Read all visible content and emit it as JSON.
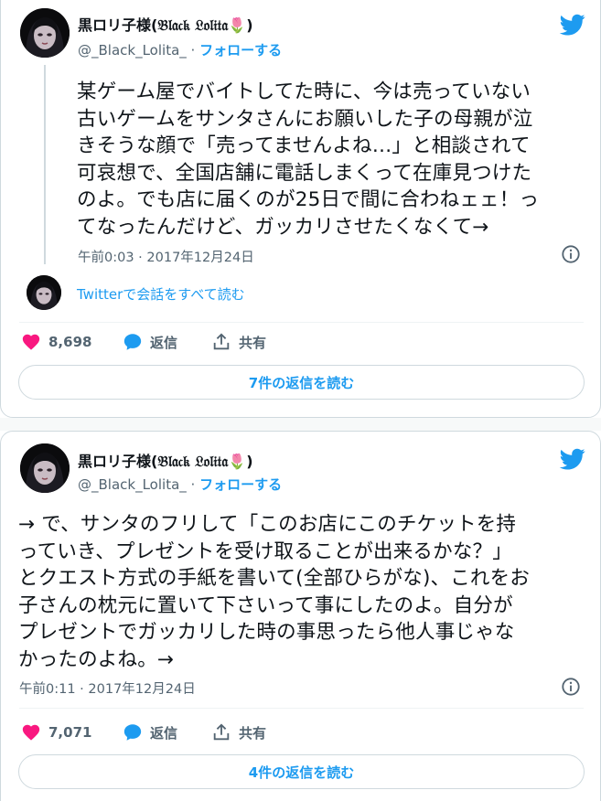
{
  "colors": {
    "accent": "#1d9bf0",
    "text": "#0f1419",
    "muted": "#536471",
    "like": "#f91880",
    "border": "#cfd9de"
  },
  "tweets": [
    {
      "author_name": "黒ロリ子様(𝔅𝔩𝔞𝔠𝔨 𝔏𝔬𝔩𝔦𝔱𝔞",
      "author_flower": "🌷",
      "author_close": ")",
      "handle": "@_Black_Lolita_",
      "separator": "·",
      "follow_label": "フォローする",
      "text": "某ゲーム屋でバイトしてた時に、今は売っていない\n古いゲームをサンタさんにお願いした子の母親が泣\nきそうな顔で「売ってませんよね…」と相談されて\n可哀想で、全国店舗に電話しまくって在庫見つけた\nのよ。でも店に届くのが25日で間に合わねェェ！っ\nてなったんだけど、ガッカリさせたくなくて→",
      "timestamp": "午前0:03 · 2017年12月24日",
      "conversation_link": "Twitterで会話をすべて読む",
      "likes": "8,698",
      "reply_label": "返信",
      "share_label": "共有",
      "read_replies": "7件の返信を読む"
    },
    {
      "author_name": "黒ロリ子様(𝔅𝔩𝔞𝔠𝔨 𝔏𝔬𝔩𝔦𝔱𝔞",
      "author_flower": "🌷",
      "author_close": ")",
      "handle": "@_Black_Lolita_",
      "separator": "·",
      "follow_label": "フォローする",
      "text": "→ で、サンタのフリして「このお店にこのチケットを持\nっていき、プレゼントを受け取ることが出来るかな？」\nとクエスト方式の手紙を書いて(全部ひらがな)、これをお\n子さんの枕元に置いて下さいって事にしたのよ。自分が\nプレゼントでガッカリした時の事思ったら他人事じゃな\nかったのよね。→",
      "timestamp": "午前0:11 · 2017年12月24日",
      "likes": "7,071",
      "reply_label": "返信",
      "share_label": "共有",
      "read_replies": "4件の返信を読む"
    }
  ],
  "icons": {
    "avatar": "avatar-image",
    "bird": "twitter-bird-icon",
    "info": "info-icon",
    "heart": "heart-icon",
    "reply": "speech-bubble-icon",
    "share": "share-icon"
  }
}
